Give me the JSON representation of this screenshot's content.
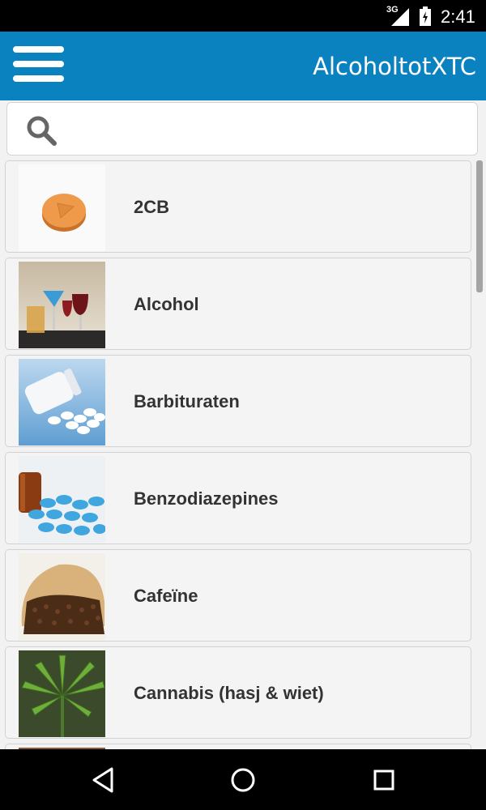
{
  "status_bar": {
    "network": "3G",
    "time": "2:41"
  },
  "app_bar": {
    "title": "AlcoholtotXTC",
    "menu_icon": "hamburger-menu-icon"
  },
  "search": {
    "placeholder": "",
    "value": "",
    "icon": "search-icon"
  },
  "items": [
    {
      "label": "2CB",
      "thumb": "orange-pill-image"
    },
    {
      "label": "Alcohol",
      "thumb": "cocktail-glasses-image"
    },
    {
      "label": "Barbituraten",
      "thumb": "pill-bottle-image"
    },
    {
      "label": "Benzodiazepines",
      "thumb": "blue-pills-image"
    },
    {
      "label": "Cafeïne",
      "thumb": "coffee-beans-image"
    },
    {
      "label": "Cannabis (hasj & wiet)",
      "thumb": "cannabis-leaf-image"
    }
  ],
  "nav_bar": {
    "back": "back-icon",
    "home": "home-icon",
    "recents": "recents-icon"
  },
  "colors": {
    "app_bar": "#0a82c0",
    "status_bar": "#000000",
    "list_bg": "#f4f4f4"
  }
}
